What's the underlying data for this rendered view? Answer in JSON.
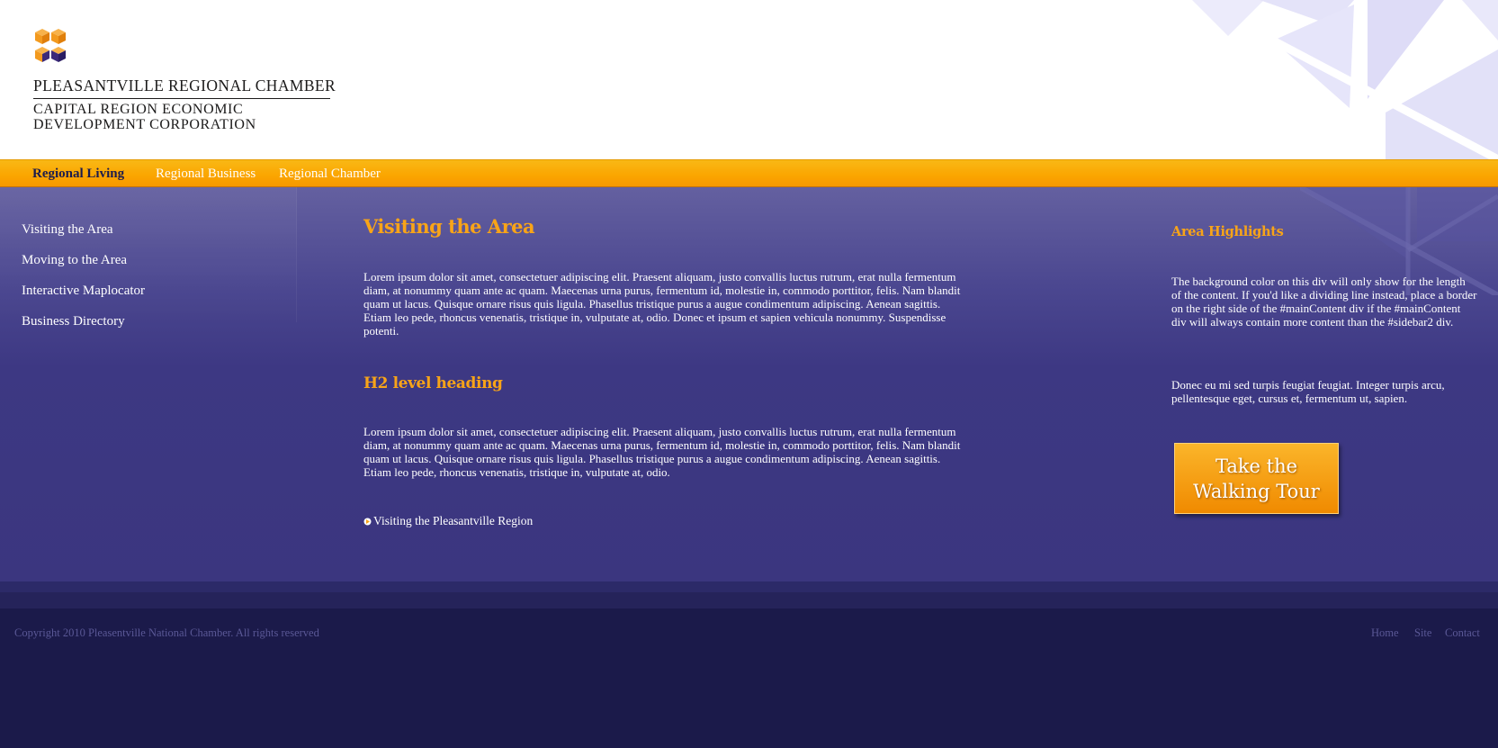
{
  "colors": {
    "accent": "#f8a418",
    "nav_bar": "#fba500",
    "main_bg": "#3d3883",
    "footer_bg": "#1b1a4a",
    "logo_orange": "#f39a1e",
    "logo_purple": "#3b2a7a"
  },
  "header": {
    "logo_icon": "cube-logo-icon",
    "brand_line_1": "PLEASANTVILLE REGIONAL CHAMBER",
    "brand_line_2": "CAPITAL REGION ECONOMIC",
    "brand_line_3": "DEVELOPMENT CORPORATION"
  },
  "nav": {
    "items": [
      {
        "label": "Regional Living",
        "active": true
      },
      {
        "label": "Regional Business",
        "active": false
      },
      {
        "label": "Regional Chamber",
        "active": false
      }
    ]
  },
  "sidebar": {
    "items": [
      {
        "label": "Visiting the Area"
      },
      {
        "label": "Moving to the Area"
      },
      {
        "label": "Interactive Maplocator"
      },
      {
        "label": "Business Directory"
      }
    ]
  },
  "main": {
    "title": "Visiting the Area",
    "paragraph_1": "Lorem ipsum dolor sit amet, consectetuer adipiscing elit. Praesent aliquam, justo convallis luctus rutrum, erat nulla fermentum diam, at nonummy quam ante ac quam. Maecenas urna purus, fermentum id, molestie in, commodo porttitor, felis. Nam blandit quam ut lacus. Quisque ornare risus quis ligula. Phasellus tristique purus a augue condimentum adipiscing. Aenean sagittis. Etiam leo pede, rhoncus venenatis, tristique in, vulputate at, odio. Donec et ipsum et sapien vehicula nonummy. Suspendisse potenti.",
    "subheading": "H2 level heading",
    "paragraph_2": "Lorem ipsum dolor sit amet, consectetuer adipiscing elit. Praesent aliquam, justo convallis luctus rutrum, erat nulla fermentum diam, at nonummy quam ante ac quam. Maecenas urna purus, fermentum id, molestie in, commodo porttitor, felis. Nam blandit quam ut lacus. Quisque ornare risus quis ligula. Phasellus tristique purus a augue condimentum adipiscing. Aenean sagittis. Etiam leo pede, rhoncus venenatis, tristique in, vulputate at, odio.",
    "link_label": "Visiting the Pleasantville Region",
    "link_icon": "bullet-arrow-icon"
  },
  "aside": {
    "title": "Area Highlights",
    "paragraph_1": "The background color on this div will only show for the length of the content. If you'd like a dividing line instead, place a border on the right side of the #mainContent div if the #mainContent div will always contain more content than the #sidebar2 div.",
    "paragraph_2": "Donec eu mi sed turpis feugiat feugiat. Integer turpis arcu, pellentesque eget, cursus et, fermentum ut, sapien.",
    "cta_line_1": "Take the",
    "cta_line_2": "Walking Tour"
  },
  "footer": {
    "copyright": "Copyright 2010 Pleasentville National Chamber. All rights reserved",
    "links": [
      {
        "label": "Home"
      },
      {
        "label": "Site"
      },
      {
        "label": "Contact"
      }
    ]
  }
}
